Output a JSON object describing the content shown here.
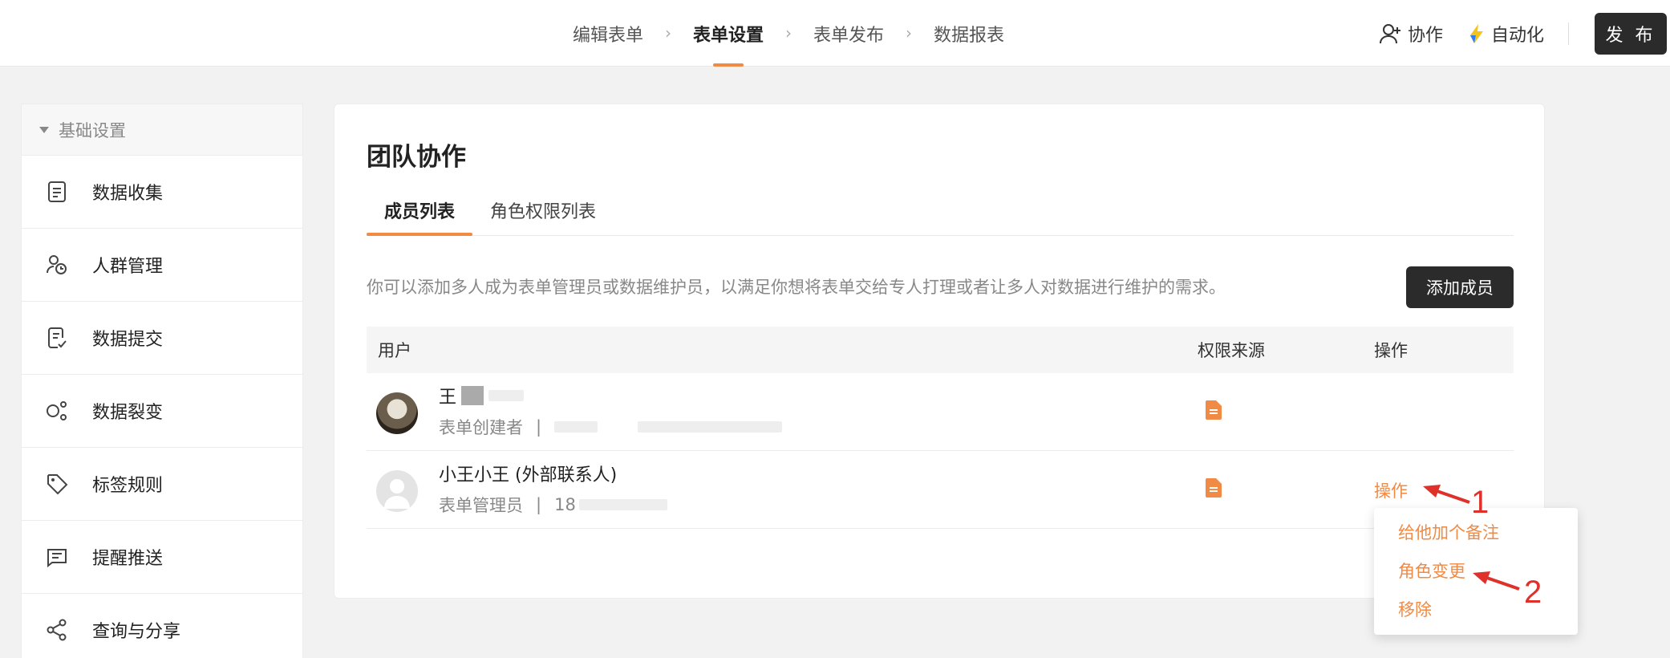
{
  "topbar": {
    "steps": [
      "编辑表单",
      "表单设置",
      "表单发布",
      "数据报表"
    ],
    "collab_label": "协作",
    "automation_label": "自动化",
    "publish_label": "发 布"
  },
  "sidebar": {
    "section": "基础设置",
    "items": [
      {
        "label": "数据收集",
        "icon": "doc-list-icon"
      },
      {
        "label": "人群管理",
        "icon": "people-icon"
      },
      {
        "label": "数据提交",
        "icon": "doc-check-icon"
      },
      {
        "label": "数据裂变",
        "icon": "fission-icon"
      },
      {
        "label": "标签规则",
        "icon": "tag-icon"
      },
      {
        "label": "提醒推送",
        "icon": "push-icon"
      },
      {
        "label": "查询与分享",
        "icon": "share-icon"
      }
    ]
  },
  "main": {
    "title": "团队协作",
    "tabs": [
      "成员列表",
      "角色权限列表"
    ],
    "description": "你可以添加多人成为表单管理员或数据维护员，以满足你想将表单交给专人打理或者让多人对数据进行维护的需求。",
    "add_button": "添加成员",
    "table": {
      "headers": [
        "用户",
        "权限来源",
        "操作"
      ],
      "rows": [
        {
          "name": "王",
          "role": "表单创建者",
          "separator": "|",
          "contact": "",
          "op": ""
        },
        {
          "name": "小王小王 (外部联系人)",
          "role": "表单管理员",
          "separator": "|",
          "contact": "18",
          "op": "操作"
        }
      ]
    },
    "dropdown": [
      "给他加个备注",
      "角色变更",
      "移除"
    ]
  },
  "annotations": [
    "1",
    "2"
  ],
  "colors": {
    "accent": "#f08a45",
    "dark_button": "#2b2b2b",
    "annotation": "#e0302a"
  }
}
